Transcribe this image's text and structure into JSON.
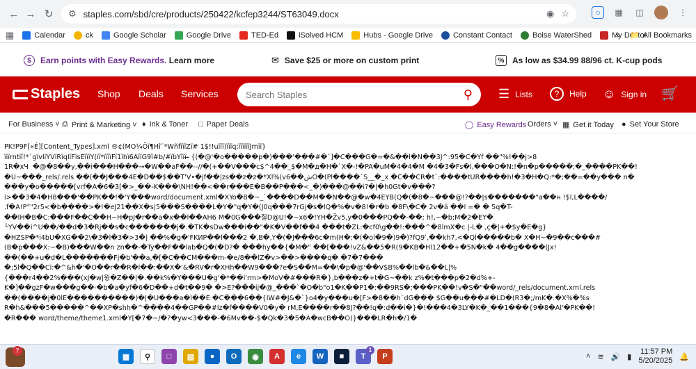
{
  "browser": {
    "url": "staples.com/sbd/cre/products/250422/kcfep3244/ST63049.docx",
    "bookmarks": [
      "Calendar",
      "ck",
      "Google Scholar",
      "Google Drive",
      "TED-Ed",
      "iSolved HCM",
      "Hubs - Google Drive",
      "Constant Contact",
      "Boise WaterShed",
      "My Doctor"
    ],
    "more": "»",
    "all_bookmarks": "All Bookmarks"
  },
  "promo": {
    "rewards_text": "Earn points with Easy Rewards.",
    "rewards_link": "Learn more",
    "print_text": "Save $25 or more on custom print",
    "kcup_text": "As low as $34.99 88/96 ct. K-cup pods"
  },
  "header": {
    "logo": "Staples",
    "nav": [
      "Shop",
      "Deals",
      "Services"
    ],
    "search_placeholder": "Search Staples",
    "lists": "Lists",
    "help": "Help",
    "signin": "Sign in"
  },
  "subnav": {
    "business": "For Business",
    "print": "Print & Marketing",
    "ink": "Ink & Toner",
    "paper": "Paper Deals",
    "rewards": "Easy Rewards",
    "orders": "Orders",
    "getit": "Get it Today",
    "store": "Set Your Store"
  },
  "content_lines": [
    "PK\u0003\u0004\u0014\u0000\u0006\u0000!P9F[«É]\u0000\u0000[Content_Types].xml ®¢(\u0000\u0000\u0000MO¼Öï¶Hî¨*WñfïïïZï# 1$!!uïïï)ïïïq;ïïïïïïJmïï}",
    "ïïïrntïï!*`gïvIïYVïRïqIïFïsEïïïY(ïï*ïïïïFï1ïhï6AïïG9ï#b/#ïbYïïï-̶ {(�@'�o�����p�)���'���#�`]�C���G�=�&��l�N��3J^:95�C�Yf ��\"%!��j>8",
    "1R�хЧ  �@�8��y,��i���H���→�W��aF��--//�(+��V���c$^4��_$�M�д�H�`X�-!�PA�uM�4�4�M �4�3�Fs�l,���O�N:!�n�p�����;�_����PK��!",
    "�U~���_rels/.rels ��(��J���4E�D��$��T'V•�jf��|zs��z�z�*Xl%(v6��شO�(Pl����`S__�_x �C��CR�t`:����tUR����h!�3�H�Q:*�;��=��y��� n�",
    "���y�o�����[vrf�A�6�3[�>_��-K���\\NH!��<��r���E�B��P���<_�)���@��i?�|�h0Gt�v���?",
    "i>��3�4�H8���'��PK��!�'Y���word/document.xml�XYo�8�~_`����D��M��N��@�w�4EYB(Q�(�8�~���@!?��|s�������\"a��н !$l,L����/",
    ".f�A!P°\"2r5<�b����>�!�eJ21��X�s|5���S����L�Y�\"q�Y�(J0q���7rGj�s�lQ�%�v�8!�r�b �8F\\�C� 2v�ā ��l =� � 5q�T-",
    "��lH�B�C:�̀��F��C��H~H�pJ�r��a�x��l��AH6 M�0G���질D@U!�~x6�!YH�Z̄v5,y�0���PQ��-��; h!,~�b;M�2�EY�",
    "└YV��i^U��/��d�3�Rj��s�c�������j�.�TK�sDw���i��\"�K�V��f��4 ���t�ZL:�cf0\\g��!:���^�8lmX�c |-L� ,ç�|+�$y�E�g}",
    "�HZSP�*i4bU�XG��2\\�3�l�3�>3�| ��%�g�'FKИP��l���2 �,B�,Y�(�J���6c�m(H�;�(�ol�9�)9�)?fQ9ʿ,��kh7,<�Ql�����b� X�H~�9��c���#",
    "(B�p���X:~�B)���W��n zn��-�Ty��F��lab�Q�(�D?� ���hy��{�M�\" ��[���!vZ&��5�R(9�KB�Hl12��+�5N�k� 4��g����(Jx!",
    "��(��+u�d�L�������Fj�b'��a,�[�C��CM���m-�e/8��lZ�v>��>����q� �7�7���",
    "�;5l�Q��Ci:�^&h�'�O��r��R�l��:��X�'&�RV�r�XHh��W9���?e�S��M=��\\�p�@'��V$B%��lb�&��L|%",
    "{���r4��2%���(xJ�w|윙�Z��|�.��k%�Y���U�g'�*��i'rm>�MoV�#���R�},b���z�+t�G~��k z%�t���p�2�d%+-",
    "K�]��gzF�w���g��-�b�a�yf�6�D��+d�t��9� �>E?���ij�@_���`�O�b\"o1�K��P1�:��9RS�;���PK��!v�S�\"��word/_rels/document.xml.rels",
    "��(����j�0lE����������)�|�U���a�l��E �C���6��{lW#�J&�`}o4�y���u�[F>�8��h`dG��� $G��u���#�LD�(R3�;/mK�.�X%�%s",
    "R�h&���5�����^��XP�shh�^����4��GP��#lz�f����V0�y� rM,E����r��8J?��!q�:d��i�}�!���4�3LY�K�_��1���{9�8�Al'�PK��!",
    "�R��� word/theme/theme1.xml�Y[�7�~/�?�yw<3���-�6Mv��-$�Qk�3�5�A�wcB��O)}���LR�h�/1�"
  ],
  "taskbar": {
    "notif_count": "7",
    "badge_count": "1",
    "time": "11:57 PM",
    "date": "5/20/2025"
  }
}
